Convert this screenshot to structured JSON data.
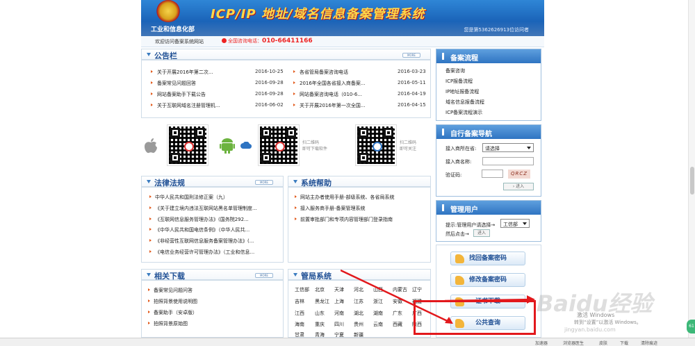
{
  "header": {
    "title": "ICP/IP 地址/域名信息备案管理系统",
    "ministry": "工业和信息化部",
    "visitor": "您是第5362626913位访问者"
  },
  "topbar": {
    "welcome": "欢迎访问备案系统网站",
    "hotline_label": "全国咨询电话：",
    "hotline_number": "010-66411166"
  },
  "announcements": {
    "title": "公告栏",
    "more": "MORE",
    "items": [
      {
        "text": "关于开展2016年第二次...",
        "date": "2016-10-25"
      },
      {
        "text": "备案常见问题回答",
        "date": "2016-09-28"
      },
      {
        "text": "网站备案助手下载公告",
        "date": "2016-09-28"
      },
      {
        "text": "关于互联网域名注册管理机...",
        "date": "2016-06-02"
      },
      {
        "text": "各省管局备案咨询电话",
        "date": "2016-03-23"
      },
      {
        "text": "2016年全国各省接入商备案...",
        "date": "2016-05-11"
      },
      {
        "text": "网站备案咨询电话（010-6...",
        "date": "2016-04-19"
      },
      {
        "text": "关于开展2016年第一次全国...",
        "date": "2016-04-15"
      }
    ]
  },
  "qr": {
    "note1_line1": "扫二维码",
    "note1_line2": "即可下载软件",
    "note2_line1": "扫二维码",
    "note2_line2": "即可关注"
  },
  "laws": {
    "title": "法律法规",
    "more": "MORE",
    "items": [
      "中华人民共和国刑法修正案（九）",
      "《关于建立境内违法互联网站黑名单管理制度...",
      "《互联网信息服务管理办法》(国务院292...",
      "《中华人民共和国电信条例》（中华人民共...",
      "《非经营性互联网信息服务备案管理办法》(...",
      "《电信业务经营许可管理办法》（工业和信息..."
    ]
  },
  "help": {
    "title": "系统帮助",
    "items": [
      "网站主办者使用手册-部级系统、各省局系统",
      "接入服务商手册-备案管理系统",
      "前置审批部门和专项内容管理部门登录指南"
    ]
  },
  "downloads": {
    "title": "相关下载",
    "more": "MORE",
    "items": [
      "备案常见问题问答",
      "拍照背景使用说明图",
      "备案助手（安卓版）",
      "拍照背景原始图"
    ]
  },
  "bureaus": {
    "title": "管局系统",
    "provinces": [
      [
        "工信部",
        "北京",
        "天津",
        "河北",
        "山西",
        "内蒙古",
        "辽宁"
      ],
      [
        "吉林",
        "黑龙江",
        "上海",
        "江苏",
        "浙江",
        "安徽",
        "福建"
      ],
      [
        "江西",
        "山东",
        "河南",
        "湖北",
        "湖南",
        "广东",
        "广西"
      ],
      [
        "海南",
        "重庆",
        "四川",
        "贵州",
        "云南",
        "西藏",
        "陕西"
      ],
      [
        "甘肃",
        "青海",
        "宁夏",
        "新疆"
      ]
    ]
  },
  "process": {
    "title": "备案流程",
    "items": [
      "备案咨询",
      "ICP报备流程",
      "IP地址报备流程",
      "域名信息报备流程",
      "ICP备案流程演示"
    ]
  },
  "nav": {
    "title": "自行备案导航",
    "province_label": "接入商所在省:",
    "province_value": "请选择",
    "name_label": "接入商名称:",
    "captcha_label": "验证码:",
    "captcha_text": "QRCZ",
    "enter": "进入"
  },
  "admin": {
    "title": "管理用户",
    "hint": "提示:管理用户请选择→",
    "select_value": "工信部",
    "then": "然后点击→",
    "enter": "进入"
  },
  "actions": {
    "find_pwd": "找回备案密码",
    "change_pwd": "修改备案密码",
    "cert_download": "证书下载",
    "public_query": "公共查询"
  },
  "watermark": {
    "brand": "Baidu经验",
    "sub": "jingyan.baidu.com",
    "activate1": "激活 Windows",
    "activate2": "转到“设置”以激活 Windows。"
  },
  "statusbar": {
    "items": [
      "加速器",
      "浏览器医生",
      "皮肤",
      "下载",
      "清除痕迹"
    ]
  },
  "float": {
    "label": "61"
  },
  "colors": {
    "accent": "#1f4f94",
    "header_blue": "#1a63b8",
    "highlight_red": "#e2181c"
  }
}
